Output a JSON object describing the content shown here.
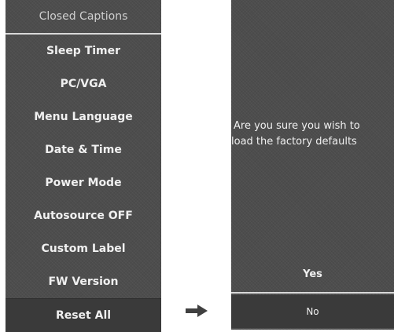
{
  "menu": {
    "title": "Closed Captions",
    "items": [
      {
        "label": "Sleep Timer"
      },
      {
        "label": "PC/VGA"
      },
      {
        "label": "Menu Language"
      },
      {
        "label": "Date & Time"
      },
      {
        "label": "Power Mode"
      },
      {
        "label": "Autosource OFF"
      },
      {
        "label": "Custom Label"
      },
      {
        "label": "FW Version"
      },
      {
        "label": "Reset All",
        "selected": true
      }
    ]
  },
  "transition": {
    "icon": "right-arrow-icon"
  },
  "dialog": {
    "message_line1": "Are you sure you wish to",
    "message_line2": "load the factory defaults",
    "yes_label": "Yes",
    "no_label": "No"
  },
  "colors": {
    "panel_bg": "#4d4d4d",
    "selected_bg": "#3a3a3a",
    "text": "#f0f0f0",
    "divider": "#d9d9d9",
    "arrow": "#404040"
  }
}
